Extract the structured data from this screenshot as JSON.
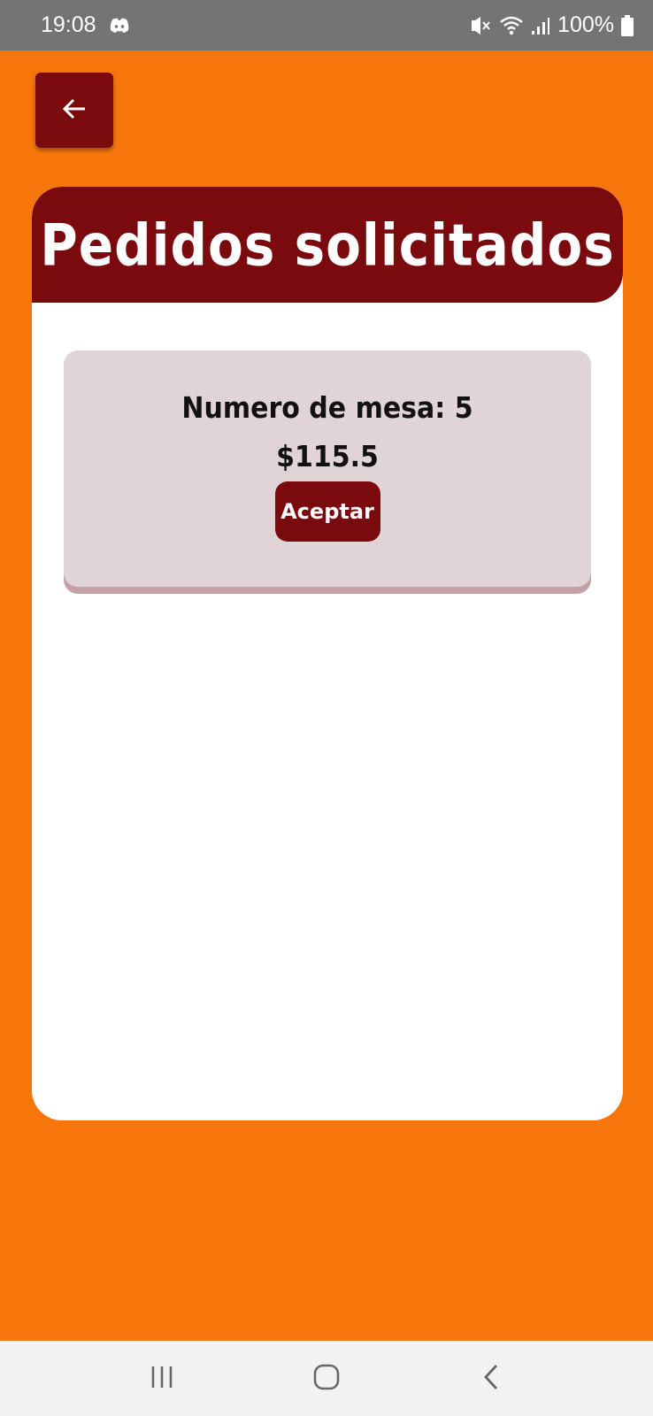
{
  "status_bar": {
    "time": "19:08",
    "battery": "100%",
    "icons": [
      "discord-icon",
      "mute-icon",
      "wifi-icon",
      "signal-icon",
      "battery-icon"
    ]
  },
  "header": {
    "back_icon": "arrow-left-icon",
    "title": "Pedidos solicitados"
  },
  "orders": [
    {
      "table_label": "Numero de mesa: 5",
      "total": "$115.5",
      "accept_label": "Aceptar"
    }
  ],
  "nav_bar": {
    "icons": [
      "recent-apps-icon",
      "home-icon",
      "back-icon"
    ]
  },
  "colors": {
    "background": "#f7760b",
    "primary": "#7a0a0e",
    "card": "#ffffff",
    "order_bg": "#e1d4d6",
    "status_bar": "#747474"
  }
}
